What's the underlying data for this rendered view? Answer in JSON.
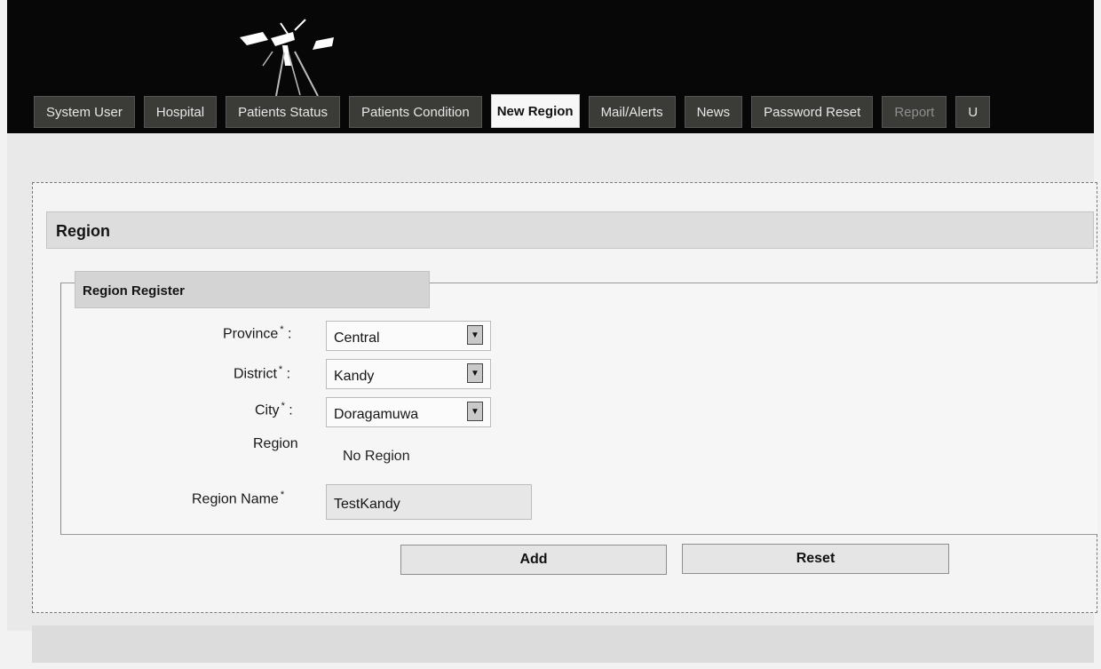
{
  "nav": {
    "tabs": [
      {
        "label": "System User"
      },
      {
        "label": "Hospital"
      },
      {
        "label": "Patients Status"
      },
      {
        "label": "Patients Condition"
      },
      {
        "label": "New Region",
        "active": true
      },
      {
        "label": "Mail/Alerts"
      },
      {
        "label": "News"
      },
      {
        "label": "Password Reset"
      },
      {
        "label": "Report",
        "dim": true
      },
      {
        "label": "U"
      }
    ]
  },
  "panel": {
    "title": "Region",
    "section_title": "Region Register"
  },
  "form": {
    "province_label": "Province",
    "province_value": "Central",
    "district_label": "District",
    "district_value": "Kandy",
    "city_label": "City",
    "city_value": "Doragamuwa",
    "region_label": "Region",
    "region_value": "No Region",
    "region_name_label": "Region Name",
    "region_name_value": "TestKandy",
    "required_marker": "*",
    "colon": ":"
  },
  "buttons": {
    "add_label": "Add",
    "reset_label": "Reset"
  },
  "icons": {
    "logo": "mosquito-logo",
    "dropdown": "chevron-down-icon"
  },
  "colors": {
    "header_background": "#070707",
    "tab_background": "#3b3b37",
    "active_tab_background": "#f7f7f7"
  }
}
